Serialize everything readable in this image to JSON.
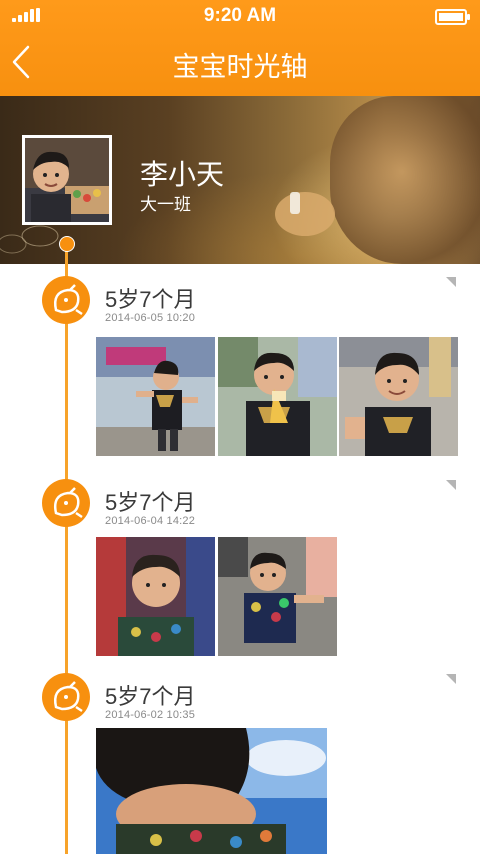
{
  "status_bar": {
    "time": "9:20 AM"
  },
  "nav": {
    "title": "宝宝时光轴"
  },
  "profile": {
    "name": "李小天",
    "class": "大一班"
  },
  "entries": [
    {
      "age": "5岁7个月",
      "date": "2014-06-05   10:20"
    },
    {
      "age": "5岁7个月",
      "date": "2014-06-04   14:22"
    },
    {
      "age": "5岁7个月",
      "date": "2014-06-02   10:35"
    }
  ],
  "colors": {
    "accent": "#f7900f",
    "timeline": "#f7a32a"
  },
  "icons": [
    "back-arrow-icon",
    "signal-icon",
    "battery-icon",
    "kid-face-icon"
  ]
}
